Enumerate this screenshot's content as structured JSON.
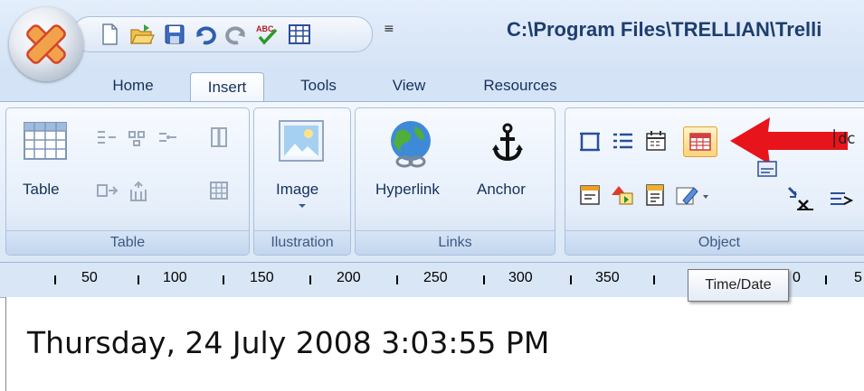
{
  "window": {
    "title": "C:\\Program Files\\TRELLIAN\\Trelli"
  },
  "quick_access": {
    "icons": [
      "new-document-icon",
      "open-folder-icon",
      "save-icon",
      "undo-icon",
      "redo-icon",
      "spellcheck-icon",
      "table-icon"
    ]
  },
  "tabs": [
    {
      "label": "Home"
    },
    {
      "label": "Insert"
    },
    {
      "label": "Tools"
    },
    {
      "label": "View"
    },
    {
      "label": "Resources"
    }
  ],
  "active_tab": "Insert",
  "ribbon": {
    "table_group": {
      "label": "Table",
      "table_button": "Table"
    },
    "illustration_group": {
      "label": "Ilustration",
      "image_button": "Image"
    },
    "links_group": {
      "label": "Links",
      "hyperlink_button": "Hyperlink",
      "anchor_button": "Anchor"
    },
    "object_group": {
      "label": "Object"
    }
  },
  "ruler": {
    "labels": [
      "50",
      "100",
      "150",
      "200",
      "250",
      "300",
      "350",
      "0",
      "5"
    ]
  },
  "tooltip": {
    "text": "Time/Date"
  },
  "document": {
    "text": "Thursday, 24 July 2008 3:03:55 PM"
  },
  "colors": {
    "accent_arrow": "#e8141b",
    "ribbon_bg": "#dbe7f6",
    "title_text": "#1e3e6e"
  }
}
